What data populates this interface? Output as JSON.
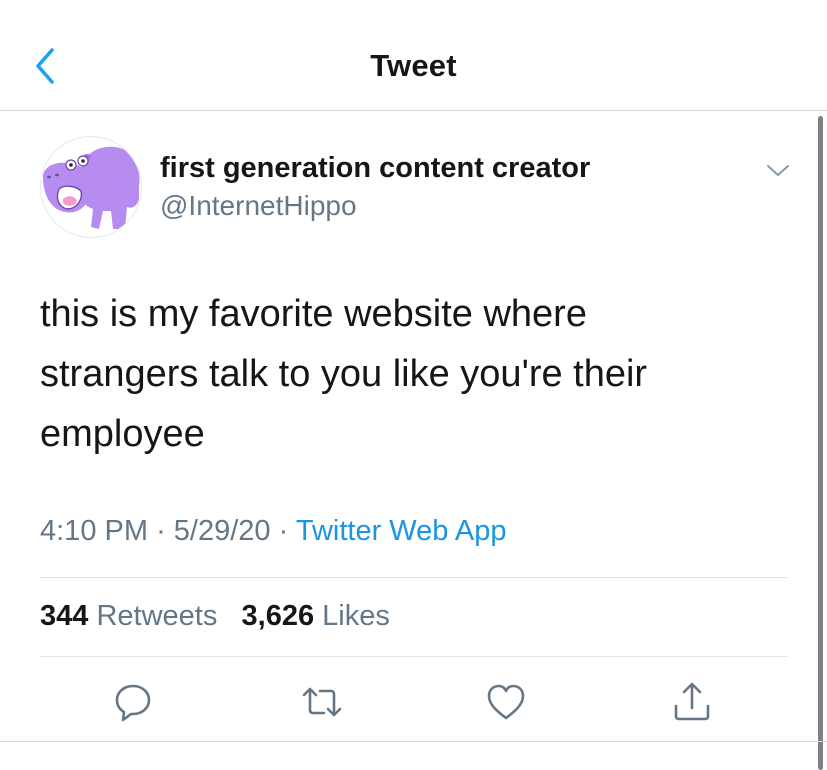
{
  "header": {
    "title": "Tweet",
    "back_icon": "chevron-left-icon",
    "accent_color": "#1da1f2"
  },
  "tweet": {
    "author": {
      "display_name": "first generation content creator",
      "handle": "@InternetHippo",
      "avatar_icon": "purple-hippo-avatar"
    },
    "text": "this is my favorite website where\nstrangers talk to you like you're their\nemployee",
    "time": "4:10 PM",
    "date": "5/29/20",
    "separator": "·",
    "source": "Twitter Web App",
    "stats": {
      "retweets_count": "344",
      "retweets_label": "Retweets",
      "likes_count": "3,626",
      "likes_label": "Likes"
    },
    "actions": [
      {
        "icon": "reply-icon"
      },
      {
        "icon": "retweet-icon"
      },
      {
        "icon": "like-icon"
      },
      {
        "icon": "share-icon"
      }
    ]
  },
  "colors": {
    "text_primary": "#14171a",
    "text_secondary": "#657786",
    "link": "#1b95e0",
    "divider": "#e1e4e6",
    "avatar_hippo": "#b78cf0"
  }
}
